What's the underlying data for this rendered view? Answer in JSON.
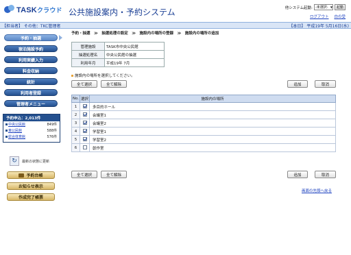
{
  "header": {
    "logo_main": "TASK",
    "logo_kana": "クラウド",
    "system_title": "公共施設案内・予約システム",
    "other_system_label": "他システム起動:",
    "other_system_value": "-未選択-",
    "launch_label": "起動",
    "links": [
      "ログアウト",
      "白の受"
    ]
  },
  "infobar": {
    "left": "【担当者】 その他：TKC管理者",
    "right": "【本日】 平成19年 5月16日(水)"
  },
  "sidebar": {
    "menu": [
      "予約・抽選",
      "宿泊施設予約",
      "利用実績入力",
      "料金収納",
      "統計",
      "利用者登録",
      "管理者メニュー"
    ],
    "apply_title": "予約申込：2,013件",
    "apply_rows": [
      {
        "name": "中央公民館",
        "count": "849件"
      },
      {
        "name": "東公民館",
        "count": "588件"
      },
      {
        "name": "総合体育館",
        "count": "576件"
      }
    ],
    "refresh_label": "最新の状態に更新",
    "gold_buttons": [
      "予約台帳",
      "お知らせ表示",
      "作成完了帳票"
    ]
  },
  "main": {
    "breadcrumb": "予約・抽選　≫　抽選処理の設定　≫　施設内の場所の登録　≫　施設内の場所の追加",
    "info_rows": [
      {
        "key": "管理施設",
        "value": "TASK市中央公民館"
      },
      {
        "key": "抽選処理名",
        "value": "中央公民館の抽選"
      },
      {
        "key": "利用年月",
        "value": "平成19年 7月"
      }
    ],
    "notice": "施設内の場所を選択してください。",
    "buttons": {
      "select_all": "全て選択",
      "clear_all": "全て解除",
      "add": "追加",
      "cancel": "取消"
    },
    "table_headers": [
      "No.",
      "選択",
      "施設内の場所"
    ],
    "rows": [
      {
        "no": "1",
        "checked": true,
        "name": "多目的ホール"
      },
      {
        "no": "2",
        "checked": true,
        "name": "会議室1"
      },
      {
        "no": "3",
        "checked": true,
        "name": "会議室2"
      },
      {
        "no": "4",
        "checked": true,
        "name": "学習室1"
      },
      {
        "no": "5",
        "checked": true,
        "name": "学習室2"
      },
      {
        "no": "6",
        "checked": false,
        "name": "創作室"
      }
    ],
    "to_top_link": "画面の先頭へ戻る"
  }
}
